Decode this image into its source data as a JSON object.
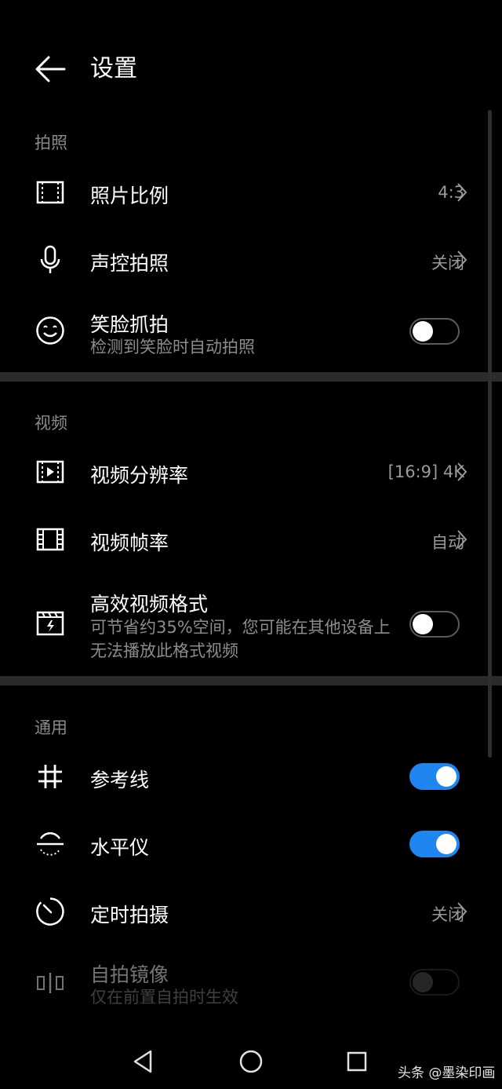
{
  "header": {
    "title": "设置",
    "back_icon": "arrow-left-icon"
  },
  "sections": {
    "photo": {
      "label": "拍照",
      "items": {
        "ratio": {
          "label": "照片比例",
          "value": "4:3",
          "icon": "aspect-ratio-icon"
        },
        "voice": {
          "label": "声控拍照",
          "value": "关闭",
          "icon": "microphone-icon"
        },
        "smile": {
          "label": "笑脸抓拍",
          "sub": "检测到笑脸时自动拍照",
          "toggle": false,
          "icon": "smile-icon"
        }
      }
    },
    "video": {
      "label": "视频",
      "items": {
        "resolution": {
          "label": "视频分辨率",
          "value": "[16:9] 4K",
          "icon": "video-resolution-icon"
        },
        "framerate": {
          "label": "视频帧率",
          "value": "自动",
          "icon": "film-frame-icon"
        },
        "hevc": {
          "label": "高效视频格式",
          "sub": "可节省约35%空间，您可能在其他设备上无法播放此格式视频",
          "toggle": false,
          "icon": "efficient-format-icon"
        }
      }
    },
    "general": {
      "label": "通用",
      "items": {
        "grid": {
          "label": "参考线",
          "toggle": true,
          "icon": "grid-icon"
        },
        "level": {
          "label": "水平仪",
          "toggle": true,
          "icon": "level-icon"
        },
        "timer": {
          "label": "定时拍摄",
          "value": "关闭",
          "icon": "timer-icon"
        },
        "mirror": {
          "label": "自拍镜像",
          "sub": "仅在前置自拍时生效",
          "toggle": false,
          "disabled": true,
          "icon": "mirror-icon"
        }
      }
    }
  },
  "colors": {
    "accent": "#1f86f0",
    "background": "#000000",
    "divider": "#2a2a2a"
  },
  "watermark": "头条 @墨染印画"
}
